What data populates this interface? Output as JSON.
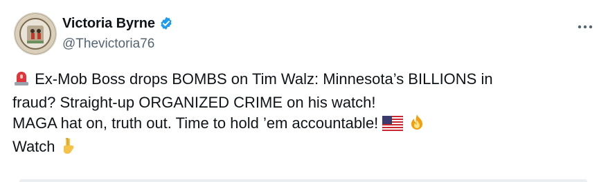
{
  "author": {
    "display_name": "Victoria Byrne",
    "handle": "@Thevictoria76",
    "verified": true
  },
  "post": {
    "line1": "Ex-Mob Boss drops BOMBS on Tim Walz: Minnesota’s BILLIONS in",
    "line2": "fraud? Straight-up ORGANIZED CRIME on his watch!",
    "line3": "MAGA hat on, truth out. Time to hold ’em accountable!",
    "line4": "Watch",
    "emoji_names": [
      "rotating-light-icon",
      "us-flag-icon",
      "fire-icon",
      "pointing-down-icon"
    ]
  },
  "colors": {
    "verified_blue": "#1d9bf0",
    "text": "#0f1419",
    "muted": "#536471"
  }
}
